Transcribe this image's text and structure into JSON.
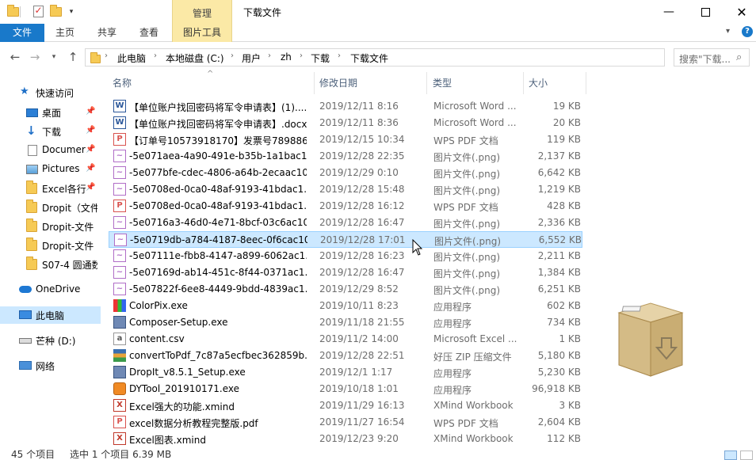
{
  "window": {
    "title": "下载文件",
    "context_tab": "管理"
  },
  "ribbon": {
    "tabs": [
      {
        "label": "文件"
      },
      {
        "label": "主页"
      },
      {
        "label": "共享"
      },
      {
        "label": "查看"
      },
      {
        "label": "图片工具"
      }
    ]
  },
  "address": {
    "crumbs": [
      "此电脑",
      "本地磁盘 (C:)",
      "用户",
      "zh",
      "下载",
      "下载文件"
    ]
  },
  "search": {
    "placeholder": "搜索\"下载..."
  },
  "navpane": {
    "items": [
      {
        "label": "快速访问",
        "icon": "star-icon",
        "pinned": false
      },
      {
        "label": "桌面",
        "icon": "desktop-icon",
        "pinned": true
      },
      {
        "label": "下载",
        "icon": "download-arrow-icon",
        "pinned": true
      },
      {
        "label": "Documer",
        "icon": "documents-icon",
        "pinned": true
      },
      {
        "label": "Pictures",
        "icon": "pictures-icon",
        "pinned": true
      },
      {
        "label": "Excel各行",
        "icon": "folder-icon",
        "pinned": true
      },
      {
        "label": "Dropit（文件",
        "icon": "folder-icon",
        "pinned": false
      },
      {
        "label": "Dropit-文件",
        "icon": "folder-icon",
        "pinned": false
      },
      {
        "label": "Dropit-文件",
        "icon": "folder-icon",
        "pinned": false
      },
      {
        "label": "S07-4 圆通数",
        "icon": "folder-icon",
        "pinned": false
      },
      {
        "label": "OneDrive",
        "icon": "cloud-icon",
        "pinned": false
      },
      {
        "label": "此电脑",
        "icon": "computer-icon",
        "pinned": false,
        "selected": true
      },
      {
        "label": "芒种 (D:)",
        "icon": "drive-icon",
        "pinned": false
      },
      {
        "label": "网络",
        "icon": "network-icon",
        "pinned": false
      }
    ]
  },
  "columns": {
    "name": "名称",
    "date": "修改日期",
    "type": "类型",
    "size": "大小"
  },
  "files": [
    {
      "name": "【单位账户找回密码将军令申请表】(1)....",
      "date": "2019/12/11 8:16",
      "type": "Microsoft Word ...",
      "size": "19 KB",
      "icon": "word-doc-icon"
    },
    {
      "name": "【单位账户找回密码将军令申请表】.docx",
      "date": "2019/12/11 8:36",
      "type": "Microsoft Word ...",
      "size": "20 KB",
      "icon": "word-doc-icon"
    },
    {
      "name": "【订单号10573918170】发票号789886...",
      "date": "2019/12/15 10:34",
      "type": "WPS PDF 文档",
      "size": "119 KB",
      "icon": "pdf-icon"
    },
    {
      "name": "-5e071aea-4a90-491e-b35b-1a1bac1...",
      "date": "2019/12/28 22:35",
      "type": "图片文件(.png)",
      "size": "2,137 KB",
      "icon": "image-icon"
    },
    {
      "name": "-5e077bfe-cdec-4806-a64b-2ecaac10...",
      "date": "2019/12/29 0:10",
      "type": "图片文件(.png)",
      "size": "6,642 KB",
      "icon": "image-icon"
    },
    {
      "name": "-5e0708ed-0ca0-48af-9193-41bdac1...",
      "date": "2019/12/28 15:48",
      "type": "图片文件(.png)",
      "size": "1,219 KB",
      "icon": "image-icon"
    },
    {
      "name": "-5e0708ed-0ca0-48af-9193-41bdac1...",
      "date": "2019/12/28 16:12",
      "type": "WPS PDF 文档",
      "size": "428 KB",
      "icon": "pdf-icon"
    },
    {
      "name": "-5e0716a3-46d0-4e71-8bcf-03c6ac10...",
      "date": "2019/12/28 16:47",
      "type": "图片文件(.png)",
      "size": "2,336 KB",
      "icon": "image-icon"
    },
    {
      "name": "-5e0719db-a784-4187-8eec-0f6cac10...",
      "date": "2019/12/28 17:01",
      "type": "图片文件(.png)",
      "size": "6,552 KB",
      "icon": "image-icon",
      "selected": true
    },
    {
      "name": "-5e07111e-fbb8-4147-a899-6062ac1...",
      "date": "2019/12/28 16:23",
      "type": "图片文件(.png)",
      "size": "2,211 KB",
      "icon": "image-icon"
    },
    {
      "name": "-5e07169d-ab14-451c-8f44-0371ac1...",
      "date": "2019/12/28 16:47",
      "type": "图片文件(.png)",
      "size": "1,384 KB",
      "icon": "image-icon"
    },
    {
      "name": "-5e07822f-6ee8-4449-9bdd-4839ac1...",
      "date": "2019/12/29 8:52",
      "type": "图片文件(.png)",
      "size": "6,251 KB",
      "icon": "image-icon"
    },
    {
      "name": "ColorPix.exe",
      "date": "2019/10/11 8:23",
      "type": "应用程序",
      "size": "602 KB",
      "icon": "colorpix-icon"
    },
    {
      "name": "Composer-Setup.exe",
      "date": "2019/11/18 21:55",
      "type": "应用程序",
      "size": "734 KB",
      "icon": "installer-icon"
    },
    {
      "name": "content.csv",
      "date": "2019/11/2 14:00",
      "type": "Microsoft Excel ...",
      "size": "1 KB",
      "icon": "csv-icon"
    },
    {
      "name": "convertToPdf_7c87a5ecfbec362859b...",
      "date": "2019/12/28 22:51",
      "type": "好压 ZIP 压缩文件",
      "size": "5,180 KB",
      "icon": "zip-icon"
    },
    {
      "name": "DropIt_v8.5.1_Setup.exe",
      "date": "2019/12/1 1:17",
      "type": "应用程序",
      "size": "5,230 KB",
      "icon": "installer-icon"
    },
    {
      "name": "DYTool_201910171.exe",
      "date": "2019/10/18 1:01",
      "type": "应用程序",
      "size": "96,918 KB",
      "icon": "app-icon"
    },
    {
      "name": "Excel强大的功能.xmind",
      "date": "2019/11/29 16:13",
      "type": "XMind Workbook",
      "size": "3 KB",
      "icon": "xmind-icon"
    },
    {
      "name": "excel数据分析教程完整版.pdf",
      "date": "2019/11/27 16:54",
      "type": "WPS PDF 文档",
      "size": "2,604 KB",
      "icon": "pdf-icon"
    },
    {
      "name": "Excel图表.xmind",
      "date": "2019/12/23 9:20",
      "type": "XMind Workbook",
      "size": "112 KB",
      "icon": "xmind-icon"
    }
  ],
  "status": {
    "count": "45 个项目",
    "selection": "选中 1 个项目 6.39 MB"
  }
}
